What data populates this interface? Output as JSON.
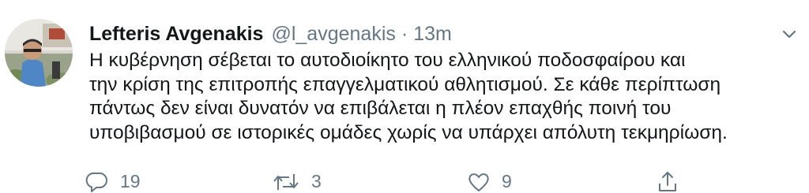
{
  "tweet": {
    "author_name": "Lefteris Avgenakis",
    "handle": "@l_avgenakis",
    "separator": "·",
    "time": "13m",
    "text_lines": [
      "Η κυβέρνηση σέβεται το αυτοδιοίκητο του ελληνικού ποδοσφαίρου και",
      "την κρίση της επιτροπής επαγγελματικού αθλητισμού. Σε κάθε περίπτωση",
      "πάντως δεν είναι δυνατόν να επιβάλεται η πλέον επαχθής ποινή του",
      "υποβιβασμού σε ιστορικές ομάδες χωρίς να υπάρχει απόλυτη τεκμηρίωση."
    ],
    "actions": {
      "reply_count": "19",
      "retweet_count": "3",
      "like_count": "9"
    },
    "colors": {
      "text": "#14171a",
      "secondary": "#657786"
    },
    "icons": [
      "avatar",
      "chevron-down-icon",
      "reply-icon",
      "retweet-icon",
      "like-icon",
      "share-icon"
    ]
  }
}
